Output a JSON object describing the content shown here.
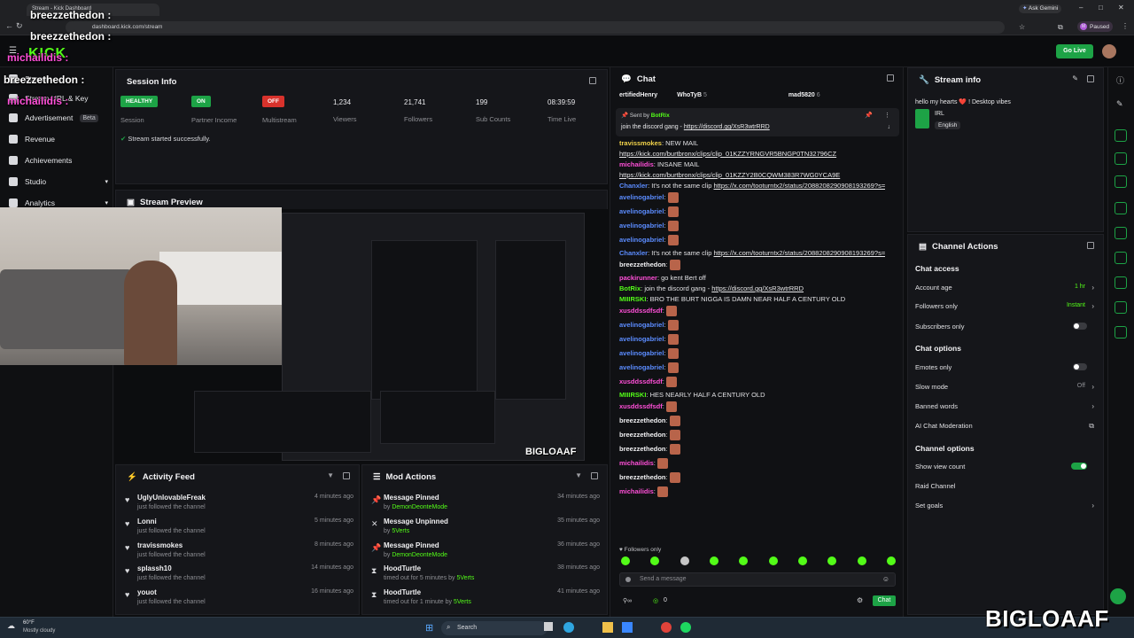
{
  "browser": {
    "tab_title": "Stream - Kick Dashboard",
    "url": "dashboard.kick.com/stream",
    "ask_gemini": "Ask Gemini",
    "profile_status": "Paused",
    "profile_initial": "M"
  },
  "topbar": {
    "logo": "KICK",
    "go_live": "Go Live"
  },
  "overlay": {
    "names": [
      "breezzethedon :",
      "breezzethedon :",
      "michailidis :",
      "breezzethedon :",
      "michailidis :"
    ],
    "watermark": "BIGLOAAF",
    "thumb_watermark": "BIGLOAAF"
  },
  "sidebar": {
    "items": [
      {
        "label": "Stream"
      },
      {
        "label": "Stream URL & Key"
      },
      {
        "label": "Advertisement",
        "badge": "Beta"
      },
      {
        "label": "Revenue"
      },
      {
        "label": "Achievements"
      },
      {
        "label": "Studio"
      },
      {
        "label": "Analytics"
      }
    ]
  },
  "session": {
    "title": "Session Info",
    "stats": [
      {
        "value": "HEALTHY",
        "label": "Session",
        "kind": "green"
      },
      {
        "value": "ON",
        "label": "Partner Income",
        "kind": "green"
      },
      {
        "value": "OFF",
        "label": "Multistream",
        "kind": "red"
      },
      {
        "value": "1,234",
        "label": "Viewers"
      },
      {
        "value": "21,741",
        "label": "Followers"
      },
      {
        "value": "199",
        "label": "Sub Counts"
      },
      {
        "value": "08:39:59",
        "label": "Time Live"
      }
    ],
    "status_msg": "Stream started successfully."
  },
  "preview": {
    "title": "Stream Preview"
  },
  "activity": {
    "title": "Activity Feed",
    "items": [
      {
        "name": "UglyUnlovableFreak",
        "sub": "just followed the channel",
        "time": "4 minutes ago"
      },
      {
        "name": "Lonni",
        "sub": "just followed the channel",
        "time": "5 minutes ago"
      },
      {
        "name": "travissmokes",
        "sub": "just followed the channel",
        "time": "8 minutes ago"
      },
      {
        "name": "splassh10",
        "sub": "just followed the channel",
        "time": "14 minutes ago"
      },
      {
        "name": "youot",
        "sub": "just followed the channel",
        "time": "16 minutes ago"
      }
    ]
  },
  "mod": {
    "title": "Mod Actions",
    "items": [
      {
        "action": "Message Pinned",
        "prefix": "by",
        "by": "DemonDeonteMode",
        "time": "34 minutes ago"
      },
      {
        "action": "Message Unpinned",
        "prefix": "by",
        "by": "5Verts",
        "time": "35 minutes ago"
      },
      {
        "action": "Message Pinned",
        "prefix": "by",
        "by": "DemonDeonteMode",
        "time": "36 minutes ago"
      },
      {
        "action": "HoodTurtle",
        "prefix": "timed out for 5 minutes by",
        "by": "5Verts",
        "time": "38 minutes ago"
      },
      {
        "action": "HoodTurtle",
        "prefix": "timed out for 1 minute by",
        "by": "5Verts",
        "time": "41 minutes ago"
      }
    ]
  },
  "chat": {
    "title": "Chat",
    "top_users": [
      "ertifiedHenry",
      "WhoTyB",
      "mad5820"
    ],
    "top_counts": [
      "5",
      "6"
    ],
    "pinned_sender_label": "Sent by",
    "pinned_sender": "BotRix",
    "pinned_text": "join the discord gang -",
    "pinned_link": "https://discord.gg/XsR3wtrRRD",
    "messages": [
      {
        "user": "travissmokes",
        "color": "yellow",
        "text": "NEW MAIL"
      },
      {
        "user": "",
        "color": "white",
        "link": "https://kick.com/burtbronx/clips/clip_01KZZYRNGVR5BNGP0TN32796CZ"
      },
      {
        "user": "michailidis",
        "color": "pink",
        "text": "INSANE MAIL"
      },
      {
        "user": "",
        "color": "white",
        "link": "https://kick.com/burtbronx/clips/clip_01KZZY2B0CQWM383R7WG0YCA9E"
      },
      {
        "user": "Chanxler",
        "color": "blue",
        "text": "It's not the same clip",
        "link": "https://x.com/tooturntx2/status/2088208290908193269?s=46"
      },
      {
        "user": "avelinogabriel",
        "color": "blue",
        "emote": true
      },
      {
        "user": "avelinogabriel",
        "color": "blue",
        "emote": true
      },
      {
        "user": "avelinogabriel",
        "color": "blue",
        "emote": true
      },
      {
        "user": "avelinogabriel",
        "color": "blue",
        "emote": true
      },
      {
        "user": "Chanxler",
        "color": "blue",
        "text": "It's not the same clip",
        "link": "https://x.com/tooturntx2/status/2088208290908193269?s=46"
      },
      {
        "user": "breezzethedon",
        "color": "white",
        "emote": true
      },
      {
        "user": "packirunner",
        "color": "pink",
        "text": "go kent Bert off"
      },
      {
        "user": "BotRix",
        "color": "green",
        "text": "join the discord gang -",
        "link": "https://discord.gg/XsR3wtrRRD"
      },
      {
        "user": "MIIIRSKI",
        "color": "green",
        "text": "BRO THE BURT NIGGA IS DAMN NEAR HALF A CENTURY OLD"
      },
      {
        "user": "xusddssdfsdf",
        "color": "pink",
        "emote": true
      },
      {
        "user": "avelinogabriel",
        "color": "blue",
        "emote": true
      },
      {
        "user": "avelinogabriel",
        "color": "blue",
        "emote": true
      },
      {
        "user": "avelinogabriel",
        "color": "blue",
        "emote": true
      },
      {
        "user": "avelinogabriel",
        "color": "blue",
        "emote": true
      },
      {
        "user": "xusddssdfsdf",
        "color": "pink",
        "emote": true
      },
      {
        "user": "MIIIRSKI",
        "color": "green",
        "text": "HES NEARLY HALF A CENTURY OLD"
      },
      {
        "user": "xusddssdfsdf",
        "color": "pink",
        "emote": true
      },
      {
        "user": "breezzethedon",
        "color": "white",
        "emote": true
      },
      {
        "user": "breezzethedon",
        "color": "white",
        "emote": true
      },
      {
        "user": "breezzethedon",
        "color": "white",
        "emote": true
      },
      {
        "user": "michailidis",
        "color": "pink",
        "emote": true
      },
      {
        "user": "breezzethedon",
        "color": "white",
        "emote": true
      },
      {
        "user": "michailidis",
        "color": "pink",
        "emote": true
      }
    ],
    "followers_only": "Followers only",
    "input_placeholder": "Send a message",
    "send_label": "Chat",
    "points": "0"
  },
  "stream_info": {
    "title": "Stream info",
    "stream_title": "hello my hearts ❤️ ! Desktop vibes",
    "category": "IRL",
    "language": "English"
  },
  "channel_actions": {
    "title": "Channel Actions",
    "sections": [
      {
        "heading": "Chat access",
        "rows": [
          {
            "label": "Account age",
            "value": "1 hr",
            "control": "chevron",
            "value_color": "#53fc18"
          },
          {
            "label": "Followers only",
            "value": "Instant",
            "control": "chevron",
            "value_color": "#53fc18"
          },
          {
            "label": "Subscribers only",
            "control": "toggle-off"
          }
        ]
      },
      {
        "heading": "Chat options",
        "rows": [
          {
            "label": "Emotes only",
            "control": "toggle-off"
          },
          {
            "label": "Slow mode",
            "value": "Off",
            "control": "chevron",
            "value_color": "#8d8e93"
          },
          {
            "label": "Banned words",
            "control": "chevron"
          },
          {
            "label": "AI Chat Moderation",
            "control": "external"
          }
        ]
      },
      {
        "heading": "Channel options",
        "rows": [
          {
            "label": "Show view count",
            "control": "toggle-on"
          },
          {
            "label": "Raid Channel",
            "control": "none"
          },
          {
            "label": "Set goals",
            "control": "chevron"
          }
        ]
      }
    ]
  },
  "taskbar": {
    "weather_temp": "60°F",
    "weather_desc": "Mostly cloudy",
    "search": "Search"
  },
  "colors": {
    "kick_green": "#53fc18",
    "panel": "#15161a",
    "bg": "#0d0e10",
    "danger": "#d8322c"
  }
}
